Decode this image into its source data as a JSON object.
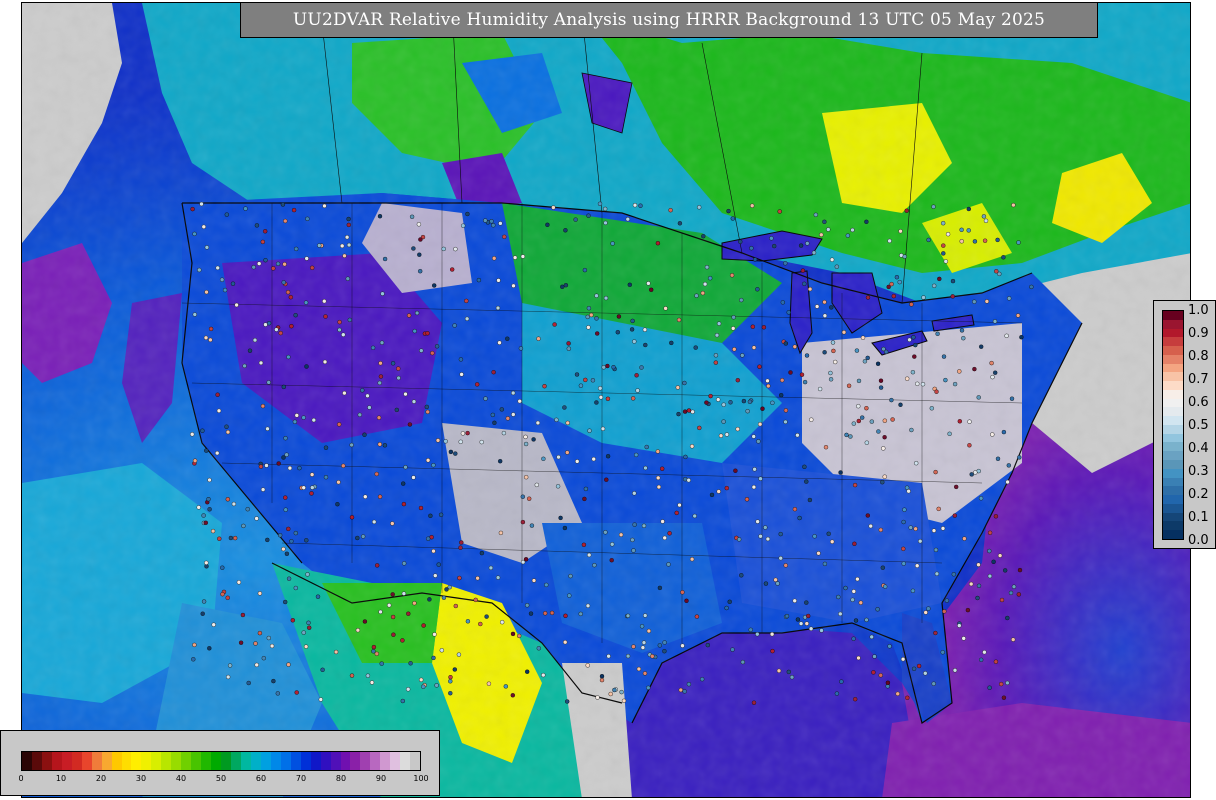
{
  "title": "UU2DVAR Relative Humidity Analysis using HRRR Background 13 UTC 05 May 2025",
  "rh_colorbar": {
    "ticks": [
      "0",
      "10",
      "20",
      "30",
      "40",
      "50",
      "60",
      "70",
      "80",
      "90",
      "100"
    ],
    "colors": [
      "#2a0505",
      "#5a0a0a",
      "#8b1010",
      "#b5151c",
      "#c81d25",
      "#d22a22",
      "#e8452c",
      "#f07c3a",
      "#f8a830",
      "#ffc800",
      "#ffdd00",
      "#ffee00",
      "#f0f000",
      "#d8ee00",
      "#b8e600",
      "#98dc00",
      "#70d000",
      "#48c400",
      "#20b800",
      "#00aa00",
      "#009a20",
      "#00a860",
      "#00b8a0",
      "#00b0c8",
      "#00a0e0",
      "#0088e8",
      "#0070e8",
      "#0050e0",
      "#0030d8",
      "#1018c8",
      "#3010c0",
      "#5010b8",
      "#7010b0",
      "#8a20a8",
      "#a040b0",
      "#b868c0",
      "#d098d0",
      "#e0c0e0",
      "#dcdcdc",
      "#c8c8c8"
    ]
  },
  "obs_colorbar": {
    "ticks": [
      "1.0",
      "0.9",
      "0.8",
      "0.7",
      "0.6",
      "0.5",
      "0.4",
      "0.3",
      "0.2",
      "0.1",
      "0.0"
    ],
    "colors": [
      "#67001f",
      "#9a1530",
      "#b2182b",
      "#c63d3d",
      "#d6604d",
      "#e58268",
      "#f4a582",
      "#f8c3a6",
      "#fddbc7",
      "#f7eee8",
      "#f0f0f0",
      "#e4eaee",
      "#d1e5f0",
      "#b4d5e6",
      "#92c5de",
      "#7ab2cc",
      "#6aa2c2",
      "#5a96b8",
      "#4393c3",
      "#3a80b4",
      "#2e6fa8",
      "#2166ac",
      "#1b5692",
      "#154678",
      "#0d3a68",
      "#053061"
    ]
  },
  "map_colors": {
    "ocean_blue": "#0a58d8",
    "ocean_cyan": "#1ab0d8",
    "purple": "#6a10b0",
    "green": "#1cb81c",
    "yellow": "#f0f000",
    "gray": "#cccccc",
    "border": "#000000"
  }
}
